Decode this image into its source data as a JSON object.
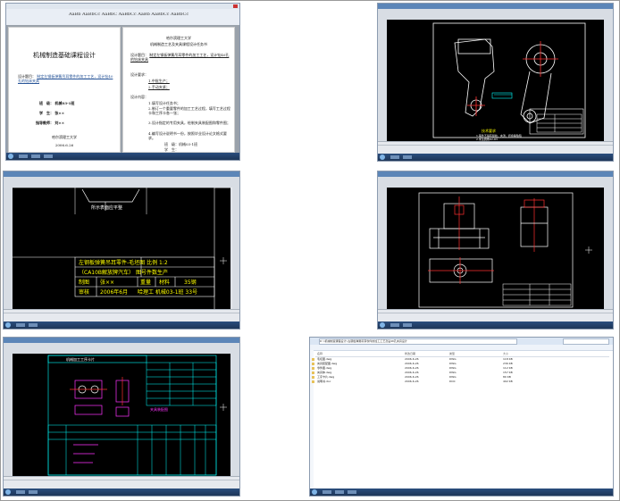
{
  "screenshots": {
    "s1_word": {
      "ribbon_text": "AaBb AaBbCc AaBbC AaBbCc AaBb AaBbCc AaBbCc",
      "page1": {
        "title": "机械制造基础课程设计",
        "topic_label": "设计题目：",
        "topic_text": "制定左钢板弹簧吊耳零件的加工工艺，设计钻40孔的钻床夹具",
        "class_label": "班　级：",
        "class_value": "机械03-1班",
        "student_label": "学　生：",
        "student_value": "张××",
        "teacher_label": "指导教师：",
        "teacher_value": "刘××",
        "school": "哈尔滨理工大学",
        "date": "2006.6.26"
      },
      "page2": {
        "head": "哈尔滨理工大学",
        "subhead": "机械制造工艺及夹具课程设计任务书",
        "topic_label": "设计题目：",
        "topic_text": "制定左钢板弹簧吊耳零件的加工工艺，设计钻40孔的钻床夹具",
        "req_label": "设计要求：",
        "req_items": [
          "1.中批生产；",
          "2.手动夹紧；"
        ],
        "content_label": "设计内容：",
        "content_items": [
          "1.填写设计任务书；",
          "2.制订一个重要零件的加工工艺过程，填写工艺过程卡和工序卡各一张；",
          "3.设计指定的专用夹具，绘制夹具装配图和零件图；",
          "4.编写设计说明书一份，按照毕业设计论文格式要求。"
        ],
        "footer_class": "班　级：机械03-1班",
        "footer_student": "学　生："
      }
    },
    "s2_cad": {
      "note_title": "技术要求",
      "notes": [
        "1.锻件不得有裂纹、夹渣、折叠等缺陷",
        "2.未注圆角R2-R3",
        "3.未注倒角1×45°"
      ]
    },
    "s3_cad": {
      "label": "所示表面应平整",
      "tb_row1": "左钢板弹簧吊耳零件-毛坯图 比例 1:2",
      "tb_row2": "（CA10B解放牌汽车）  图号件数生产",
      "tb_row3a": "制图",
      "tb_row3b": "张××",
      "tb_row3c": "重量",
      "tb_row3d": "材料",
      "tb_row3e": "35钢",
      "tb_row4a": "审核",
      "tb_row4b": "2006年6月",
      "tb_row4c": "哈理工 机械03-1班 33号"
    },
    "s5_cad": {
      "header": "机械加工工序卡片",
      "side_text": "夹具装配图"
    },
    "s6_explorer": {
      "address": "D:\\机械制造课程设计\\左钢板弹簧吊耳零件的加工工艺及钻40孔夹具设计",
      "columns": [
        "名称",
        "修改日期",
        "类型",
        "大小"
      ],
      "rows": [
        {
          "name": "毛坯图.dwg",
          "date": "2006-6-26",
          "type": "DWG",
          "size": "118 KB"
        },
        {
          "name": "夹具装配图.dwg",
          "date": "2006-6-26",
          "type": "DWG",
          "size": "236 KB"
        },
        {
          "name": "零件图.dwg",
          "date": "2006-6-26",
          "type": "DWG",
          "size": "112 KB"
        },
        {
          "name": "夹具体.dwg",
          "date": "2006-6-26",
          "type": "DWG",
          "size": "157 KB"
        },
        {
          "name": "工序卡片.dwg",
          "date": "2006-6-26",
          "type": "DWG",
          "size": "89 KB"
        },
        {
          "name": "说明书.doc",
          "date": "2006-6-26",
          "type": "DOC",
          "size": "402 KB"
        }
      ]
    }
  },
  "colors": {
    "cad_bg": "#000000",
    "cad_yellow": "#ffff00",
    "cad_cyan": "#00ffff",
    "cad_red": "#ff3030",
    "cad_magenta": "#ff33ff",
    "word_blue": "#2a5699"
  }
}
